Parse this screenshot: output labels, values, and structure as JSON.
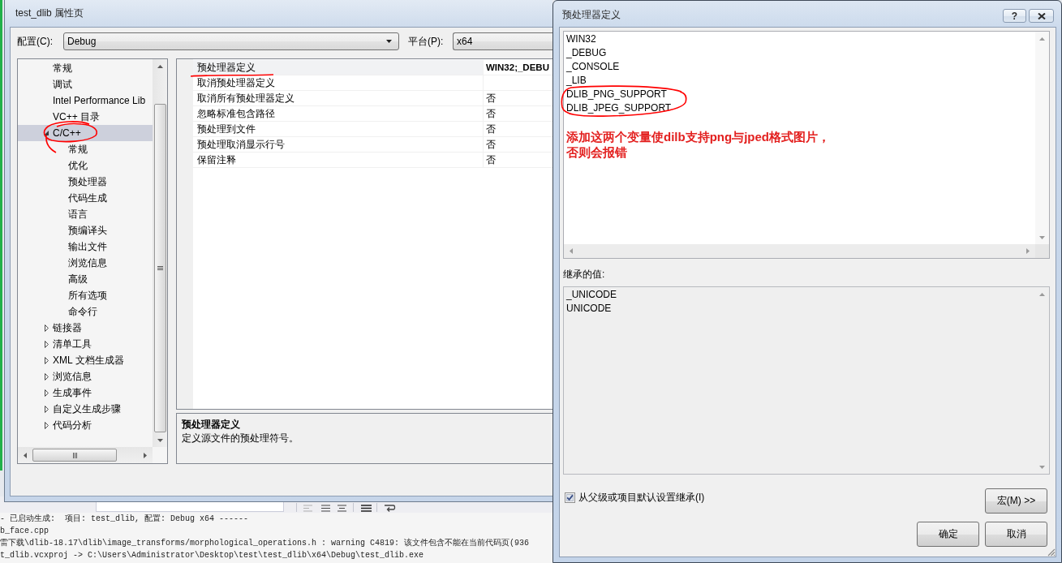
{
  "property_window": {
    "title": "test_dlib 属性页",
    "configuration": {
      "label": "配置(C):",
      "value": "Debug"
    },
    "platform": {
      "label": "平台(P):",
      "value": "x64"
    },
    "tree": [
      {
        "label": "常规",
        "selected": false
      },
      {
        "label": "调试",
        "selected": false
      },
      {
        "label": "Intel Performance Lib",
        "selected": false
      },
      {
        "label": "VC++ 目录",
        "selected": false
      },
      {
        "label": "C/C++",
        "selected": true,
        "expanded": true,
        "children": [
          {
            "label": "常规",
            "selected": false
          },
          {
            "label": "优化",
            "selected": false
          },
          {
            "label": "预处理器",
            "selected": false
          },
          {
            "label": "代码生成",
            "selected": false
          },
          {
            "label": "语言",
            "selected": false
          },
          {
            "label": "预编译头",
            "selected": false
          },
          {
            "label": "输出文件",
            "selected": false
          },
          {
            "label": "浏览信息",
            "selected": false
          },
          {
            "label": "高级",
            "selected": false
          },
          {
            "label": "所有选项",
            "selected": false
          },
          {
            "label": "命令行",
            "selected": false
          }
        ]
      },
      {
        "label": "链接器",
        "selected": false,
        "expanded": false
      },
      {
        "label": "清单工具",
        "selected": false,
        "expanded": false
      },
      {
        "label": "XML 文档生成器",
        "selected": false,
        "expanded": false
      },
      {
        "label": "浏览信息",
        "selected": false,
        "expanded": false
      },
      {
        "label": "生成事件",
        "selected": false,
        "expanded": false
      },
      {
        "label": "自定义生成步骤",
        "selected": false,
        "expanded": false
      },
      {
        "label": "代码分析",
        "selected": false,
        "expanded": false
      }
    ],
    "grid_rows": [
      {
        "name": "预处理器定义",
        "value": "WIN32;_DEBU",
        "modified": true,
        "selected": true
      },
      {
        "name": "取消预处理器定义",
        "selected": false
      },
      {
        "name": "取消所有预处理器定义",
        "value": "否",
        "modified": false,
        "selected": false
      },
      {
        "name": "忽略标准包含路径",
        "value": "否",
        "modified": false,
        "selected": false
      },
      {
        "name": "预处理到文件",
        "value": "否",
        "modified": false,
        "selected": false
      },
      {
        "name": "预处理取消显示行号",
        "value": "否",
        "modified": false,
        "selected": false
      },
      {
        "name": "保留注释",
        "value": "否",
        "modified": false,
        "selected": false
      }
    ],
    "description": {
      "title": "预处理器定义",
      "text": "定义源文件的预处理符号。"
    }
  },
  "output_panel": {
    "lines": [
      "- 已启动生成:  项目: test_dlib, 配置: Debug x64 ------",
      "b_face.cpp",
      "雷下载\\dlib-18.17\\dlib\\image_transforms/morphological_operations.h : warning C4819: 该文件包含不能在当前代码页(936",
      "t_dlib.vcxproj -> C:\\Users\\Administrator\\Desktop\\test\\test_dlib\\x64\\Debug\\test_dlib.exe"
    ]
  },
  "dialog": {
    "title": "预处理器定义",
    "help_button": "?",
    "definitions": [
      "WIN32",
      "_DEBUG",
      "_CONSOLE",
      "_LIB",
      "DLIB_PNG_SUPPORT",
      "DLIB_JPEG_SUPPORT"
    ],
    "annotation_note": [
      "添加这两个变量使dilb支持png与jped格式图片，",
      "否则会报错"
    ],
    "inherited_label": "继承的值:",
    "inherited_values": [
      "_UNICODE",
      "UNICODE"
    ],
    "inherit_checkbox": {
      "label": "从父级或项目默认设置继承(I)",
      "checked": true
    },
    "buttons": [
      {
        "kind": "macro",
        "label": "宏(M) >>"
      },
      {
        "kind": "ok",
        "label": "确定"
      },
      {
        "kind": "cancel",
        "label": "取消"
      }
    ]
  }
}
